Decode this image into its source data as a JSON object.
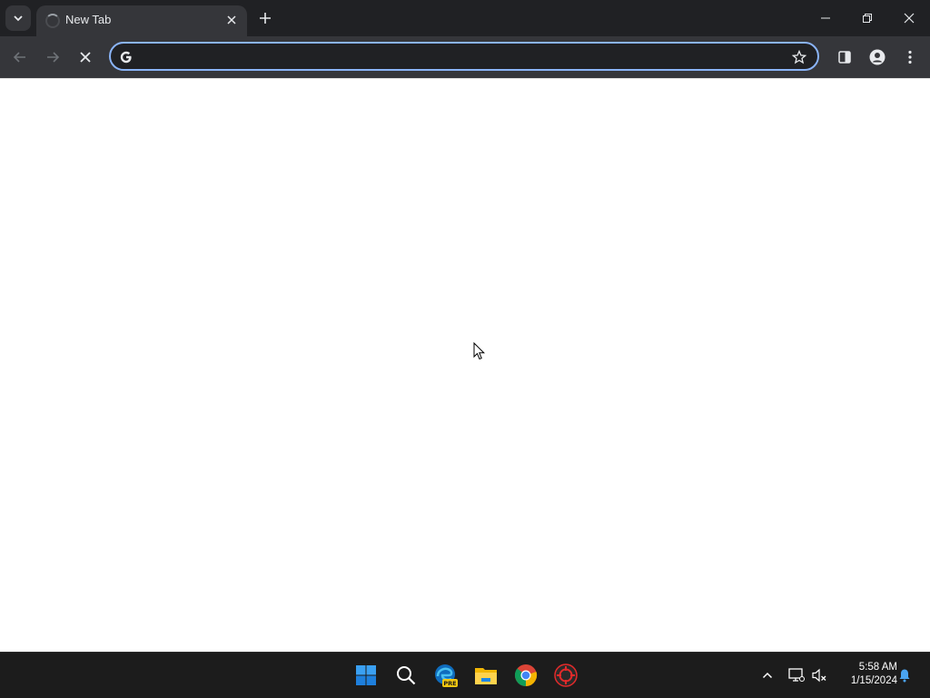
{
  "browser": {
    "tab": {
      "title": "New Tab",
      "loading": true
    },
    "omnibox": {
      "value": "",
      "placeholder": ""
    },
    "icons": {
      "tab_search": "chevron-down-icon",
      "close_tab": "close-icon",
      "new_tab": "plus-icon",
      "back": "arrow-left-icon",
      "forward": "arrow-right-icon",
      "stop": "stop-x-icon",
      "search_engine": "google-g-icon",
      "bookmark": "star-icon",
      "side_panel": "side-panel-icon",
      "profile": "profile-icon",
      "menu": "kebab-menu-icon"
    },
    "accent_color": "#8ab4f8"
  },
  "taskbar": {
    "apps": [
      "start",
      "search",
      "edge-preview",
      "file-explorer",
      "chrome",
      "app"
    ],
    "edge_badge": "PRE",
    "clock": {
      "time": "5:58 AM",
      "date": "1/15/2024"
    }
  }
}
